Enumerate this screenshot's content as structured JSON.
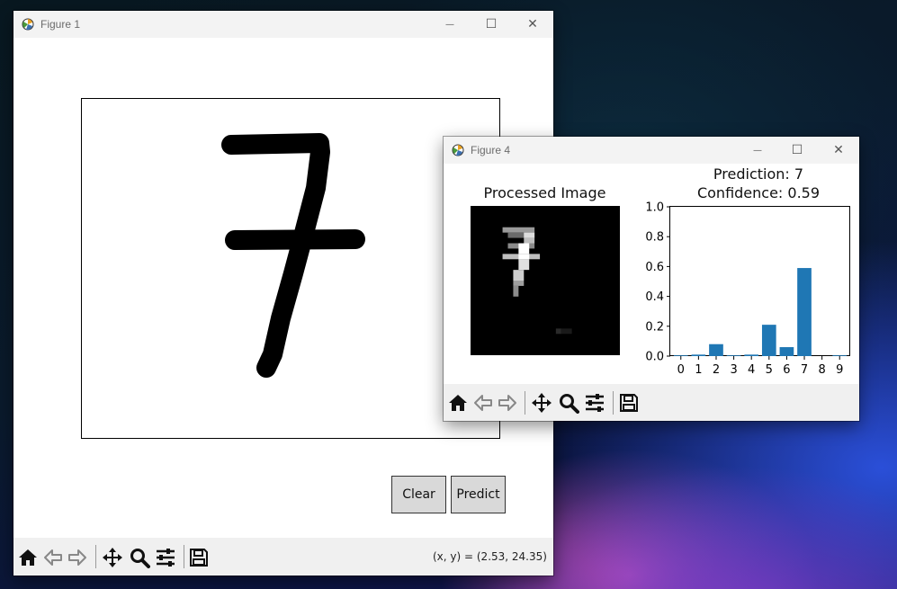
{
  "figure1": {
    "title": "Figure 1",
    "buttons": {
      "clear": "Clear",
      "predict": "Predict"
    },
    "coord_readout": "(x, y) = (2.53, 24.35)",
    "toolbar_icons": [
      "home-icon",
      "back-icon",
      "forward-icon",
      "pan-icon",
      "zoom-icon",
      "configure-icon",
      "save-icon"
    ]
  },
  "figure4": {
    "title": "Figure 4",
    "image_title": "Processed Image",
    "prediction_line": "Prediction: 7",
    "confidence_line": "Confidence: 0.59",
    "toolbar_icons": [
      "home-icon",
      "back-icon",
      "forward-icon",
      "pan-icon",
      "zoom-icon",
      "configure-icon",
      "save-icon"
    ]
  },
  "window_controls": {
    "minimize": "—",
    "maximize": "☐",
    "close": "✕"
  },
  "chart_data": {
    "type": "bar",
    "categories": [
      "0",
      "1",
      "2",
      "3",
      "4",
      "5",
      "6",
      "7",
      "8",
      "9"
    ],
    "values": [
      0.005,
      0.01,
      0.08,
      0.005,
      0.01,
      0.21,
      0.06,
      0.59,
      0.0,
      0.005
    ],
    "yticks": [
      "0.0",
      "0.2",
      "0.4",
      "0.6",
      "0.8",
      "1.0"
    ],
    "ylim": [
      0,
      1
    ],
    "color": "#1f77b4"
  }
}
